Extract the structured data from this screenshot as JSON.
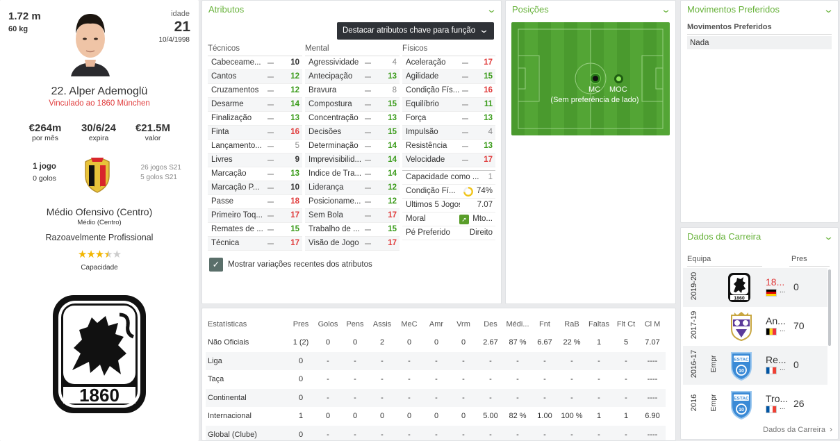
{
  "profile": {
    "height": "1.72 m",
    "weight": "60 kg",
    "age_label": "idade",
    "age": "21",
    "dob": "10/4/1998",
    "name": "22. Alper Ademoglü",
    "contract": "Vinculado ao 1860 München",
    "wage": "€264m",
    "wage_label": "por mês",
    "expires": "30/6/24",
    "expires_label": "expira",
    "value": "€21.5M",
    "value_label": "valor",
    "caps": "1 jogo",
    "goals": "0 golos",
    "u21_caps": "26 jogos S21",
    "u21_goals": "5 golos S21",
    "position": "Médio Ofensivo (Centro)",
    "position_sub": "Médio (Centro)",
    "status": "Razoavelmente Profissional",
    "stars": 3.5,
    "ability_label": "Capacidade",
    "club_badge_text": "1860"
  },
  "attributes": {
    "title": "Atributos",
    "highlight_button": "Destacar atributos chave para função",
    "checkbox_label": "Mostrar variações recentes dos atributos",
    "technical": {
      "header": "Técnicos",
      "rows": [
        {
          "name": "Cabeceame...",
          "value": "10"
        },
        {
          "name": "Cantos",
          "value": "12"
        },
        {
          "name": "Cruzamentos",
          "value": "12"
        },
        {
          "name": "Desarme",
          "value": "14"
        },
        {
          "name": "Finalização",
          "value": "13"
        },
        {
          "name": "Finta",
          "value": "16"
        },
        {
          "name": "Lançamento...",
          "value": "5"
        },
        {
          "name": "Livres",
          "value": "9"
        },
        {
          "name": "Marcação",
          "value": "13"
        },
        {
          "name": "Marcação P...",
          "value": "10"
        },
        {
          "name": "Passe",
          "value": "18"
        },
        {
          "name": "Primeiro Toq...",
          "value": "17"
        },
        {
          "name": "Remates de ...",
          "value": "15"
        },
        {
          "name": "Técnica",
          "value": "17"
        }
      ]
    },
    "mental": {
      "header": "Mental",
      "rows": [
        {
          "name": "Agressividade",
          "value": "4"
        },
        {
          "name": "Antecipação",
          "value": "13"
        },
        {
          "name": "Bravura",
          "value": "8"
        },
        {
          "name": "Compostura",
          "value": "15"
        },
        {
          "name": "Concentração",
          "value": "13"
        },
        {
          "name": "Decisões",
          "value": "15"
        },
        {
          "name": "Determinação",
          "value": "14"
        },
        {
          "name": "Imprevisibilid...",
          "value": "14"
        },
        {
          "name": "Índice de Tra...",
          "value": "14"
        },
        {
          "name": "Liderança",
          "value": "12"
        },
        {
          "name": "Posicioname...",
          "value": "12"
        },
        {
          "name": "Sem Bola",
          "value": "17"
        },
        {
          "name": "Trabalho de ...",
          "value": "15"
        },
        {
          "name": "Visão de Jogo",
          "value": "17"
        }
      ]
    },
    "physical": {
      "header": "Físicos",
      "rows": [
        {
          "name": "Aceleração",
          "value": "17"
        },
        {
          "name": "Agilidade",
          "value": "15"
        },
        {
          "name": "Condição Fís...",
          "value": "16"
        },
        {
          "name": "Equilíbrio",
          "value": "11"
        },
        {
          "name": "Força",
          "value": "13"
        },
        {
          "name": "Impulsão",
          "value": "4"
        },
        {
          "name": "Resistência",
          "value": "13"
        },
        {
          "name": "Velocidade",
          "value": "17"
        }
      ]
    },
    "other": [
      {
        "name": "Capacidade como ...",
        "value": "1"
      },
      {
        "name": "Condição Fí...",
        "value": "74%"
      },
      {
        "name": "Últimos 5 Jogos",
        "value": "7.07"
      },
      {
        "name": "Moral",
        "value": "Mto..."
      },
      {
        "name": "Pé Preferido",
        "value": "Direito"
      }
    ],
    "condition_fraction": 0.74
  },
  "positions": {
    "title": "Posições",
    "pos1": "MC",
    "pos2": "MOC",
    "side_note": "(Sem preferência de lado)"
  },
  "moves": {
    "title": "Movimentos Preferidos",
    "header": "Movimentos Preferidos",
    "value": "Nada"
  },
  "career": {
    "title": "Dados da Carreira",
    "col_team": "Equipa",
    "col_apps": "Pres",
    "rows": [
      {
        "season": "2019-20",
        "loan": "",
        "team": "18...",
        "nat": "...",
        "apps": "0",
        "badge": "1860"
      },
      {
        "season": "2017-19",
        "loan": "",
        "team": "An...",
        "nat": "...",
        "apps": "70",
        "badge": "RSCA"
      },
      {
        "season": "2016-17",
        "loan": "Empr",
        "team": "Re...",
        "nat": "...",
        "apps": "0",
        "badge": "ESTAC"
      },
      {
        "season": "2016",
        "loan": "Empr",
        "team": "Tro...",
        "nat": "...",
        "apps": "26",
        "badge": "ESTAC"
      }
    ],
    "link": "Dados da Carreira"
  },
  "stats": {
    "headers": [
      "Estatísticas",
      "Pres",
      "Golos",
      "Pens",
      "Assis",
      "MeC",
      "Amr",
      "Vrm",
      "Des",
      "Médi...",
      "Fnt",
      "RaB",
      "Faltas",
      "Flt Ct",
      "Cl M"
    ],
    "rows": [
      [
        "Não Oficiais",
        "1 (2)",
        "0",
        "0",
        "2",
        "0",
        "0",
        "0",
        "2.67",
        "87 %",
        "6.67",
        "22 %",
        "1",
        "5",
        "7.07"
      ],
      [
        "Liga",
        "0",
        "-",
        "-",
        "-",
        "-",
        "-",
        "-",
        "-",
        "-",
        "-",
        "-",
        "-",
        "-",
        "----"
      ],
      [
        "Taça",
        "0",
        "-",
        "-",
        "-",
        "-",
        "-",
        "-",
        "-",
        "-",
        "-",
        "-",
        "-",
        "-",
        "----"
      ],
      [
        "Continental",
        "0",
        "-",
        "-",
        "-",
        "-",
        "-",
        "-",
        "-",
        "-",
        "-",
        "-",
        "-",
        "-",
        "----"
      ],
      [
        "Internacional",
        "1",
        "0",
        "0",
        "0",
        "0",
        "0",
        "0",
        "5.00",
        "82 %",
        "1.00",
        "100 %",
        "1",
        "1",
        "6.90"
      ],
      [
        "Global (Clube)",
        "0",
        "-",
        "-",
        "-",
        "-",
        "-",
        "-",
        "-",
        "-",
        "-",
        "-",
        "-",
        "-",
        "----"
      ]
    ]
  },
  "colors": {
    "accent": "#67b23a",
    "high": "#3a9b1a",
    "top": "#e03b3b",
    "pitch": "#4a9a2e"
  }
}
